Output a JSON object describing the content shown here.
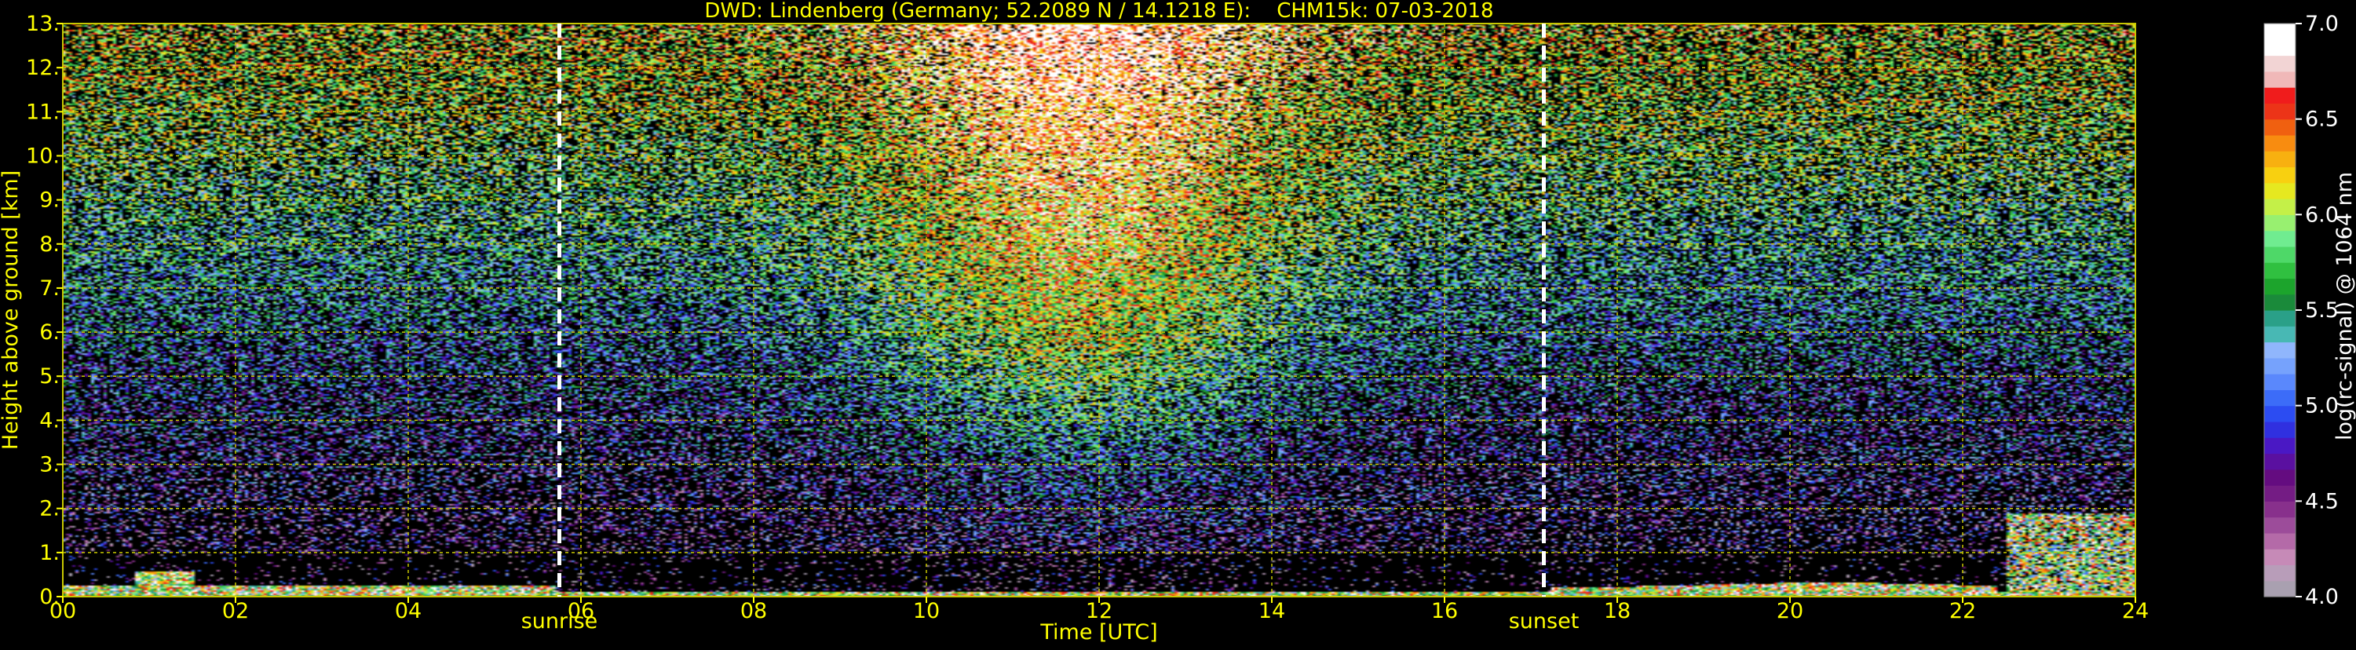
{
  "chart_data": {
    "type": "heatmap",
    "title": "DWD: Lindenberg (Germany; 52.2089 N / 14.1218 E):    CHM15k: 07-03-2018",
    "xlabel": "Time [UTC]",
    "ylabel": "Height above ground [km]",
    "xlim": [
      0,
      24
    ],
    "ylim": [
      0,
      13
    ],
    "x_ticks": [
      {
        "value": 0,
        "label": "00"
      },
      {
        "value": 2,
        "label": "02"
      },
      {
        "value": 4,
        "label": "04"
      },
      {
        "value": 6,
        "label": "06"
      },
      {
        "value": 8,
        "label": "08"
      },
      {
        "value": 10,
        "label": "10"
      },
      {
        "value": 12,
        "label": "12"
      },
      {
        "value": 14,
        "label": "14"
      },
      {
        "value": 16,
        "label": "16"
      },
      {
        "value": 18,
        "label": "18"
      },
      {
        "value": 20,
        "label": "20"
      },
      {
        "value": 22,
        "label": "22"
      },
      {
        "value": 24,
        "label": "24"
      }
    ],
    "y_ticks": [
      {
        "value": 0,
        "label": "0."
      },
      {
        "value": 1,
        "label": "1."
      },
      {
        "value": 2,
        "label": "2."
      },
      {
        "value": 3,
        "label": "3."
      },
      {
        "value": 4,
        "label": "4."
      },
      {
        "value": 5,
        "label": "5."
      },
      {
        "value": 6,
        "label": "6."
      },
      {
        "value": 7,
        "label": "7."
      },
      {
        "value": 8,
        "label": "8."
      },
      {
        "value": 9,
        "label": "9."
      },
      {
        "value": 10,
        "label": "10."
      },
      {
        "value": 11,
        "label": "11."
      },
      {
        "value": 12,
        "label": "12."
      },
      {
        "value": 13,
        "label": "13."
      }
    ],
    "grid": true,
    "annotations": [
      {
        "x": 5.75,
        "label": "sunrise",
        "style": "dashed-vertical-line"
      },
      {
        "x": 17.15,
        "label": "sunset",
        "style": "dashed-vertical-line"
      }
    ],
    "colorbar": {
      "label": "log(rc-signal) @ 1064 nm",
      "range": [
        4.0,
        7.0
      ],
      "ticks": [
        {
          "value": 4.0,
          "label": "4.0"
        },
        {
          "value": 4.5,
          "label": "4.5"
        },
        {
          "value": 5.0,
          "label": "5.0"
        },
        {
          "value": 5.5,
          "label": "5.5"
        },
        {
          "value": 6.0,
          "label": "6.0"
        },
        {
          "value": 6.5,
          "label": "6.5"
        },
        {
          "value": 7.0,
          "label": "7.0"
        }
      ],
      "colors": [
        "#a9a0b0",
        "#b89db9",
        "#c68ab7",
        "#b46aa8",
        "#9c4c9a",
        "#88308c",
        "#741c84",
        "#640c80",
        "#5a10a0",
        "#4a18c4",
        "#3030e0",
        "#2c4cf2",
        "#3c6cf8",
        "#5a88fc",
        "#76a2fc",
        "#90b6fc",
        "#48b8b4",
        "#2aa088",
        "#1a8a3a",
        "#1ca42c",
        "#30c040",
        "#4ed868",
        "#70ec90",
        "#98f070",
        "#c4f048",
        "#e6e820",
        "#f8d010",
        "#f8b010",
        "#f88c10",
        "#f06010",
        "#ec3418",
        "#f01c1c",
        "#f0b8b8",
        "#f2d4d4",
        "#ffffff",
        "#ffffff"
      ]
    },
    "colors": {
      "background": "#000000",
      "axis_text": "#ffff00",
      "colorbar_text": "#ffffff",
      "grid": "#c8c800",
      "marker_line": "#ffffff"
    }
  }
}
